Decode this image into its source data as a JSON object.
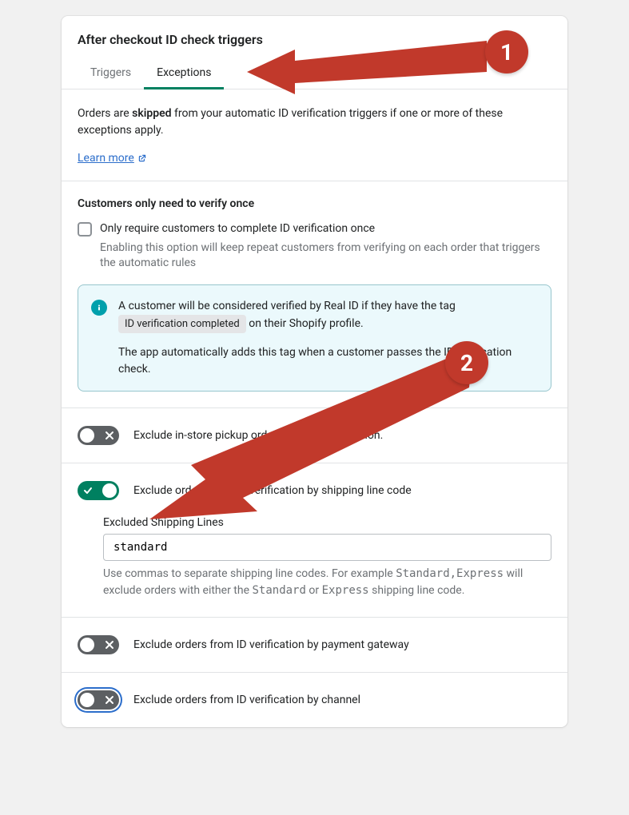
{
  "header": {
    "title": "After checkout ID check triggers",
    "tabs": [
      {
        "label": "Triggers",
        "active": false
      },
      {
        "label": "Exceptions",
        "active": true
      }
    ]
  },
  "intro": {
    "prefix": "Orders are ",
    "bold": "skipped",
    "suffix": " from your automatic ID verification triggers if one or more of these exceptions apply.",
    "learn_more": "Learn more"
  },
  "verify_once": {
    "heading": "Customers only need to verify once",
    "checkbox_label": "Only require customers to complete ID verification once",
    "checkbox_desc": "Enabling this option will keep repeat customers from verifying on each order that triggers the automatic rules",
    "info": {
      "line1_prefix": "A customer will be considered verified by Real ID if they have the tag ",
      "tag": "ID verification completed",
      "line1_suffix": " on their Shopify profile.",
      "line2": "The app automatically adds this tag when a customer passes the ID verification check."
    }
  },
  "toggles": {
    "instore": {
      "label": "Exclude in-store pickup orders from ID verification."
    },
    "shipping": {
      "label": "Exclude orders from ID verification by shipping line code",
      "field_label": "Excluded Shipping Lines",
      "value": "standard",
      "help_prefix": "Use commas to separate shipping line codes. For example ",
      "help_example": "Standard,Express",
      "help_mid": " will exclude orders with either the ",
      "help_code1": "Standard",
      "help_or": " or ",
      "help_code2": "Express",
      "help_suffix": " shipping line code."
    },
    "gateway": {
      "label": "Exclude orders from ID verification by payment gateway"
    },
    "channel": {
      "label": "Exclude orders from ID verification by channel"
    }
  },
  "annotations": {
    "badge1": "1",
    "badge2": "2"
  }
}
